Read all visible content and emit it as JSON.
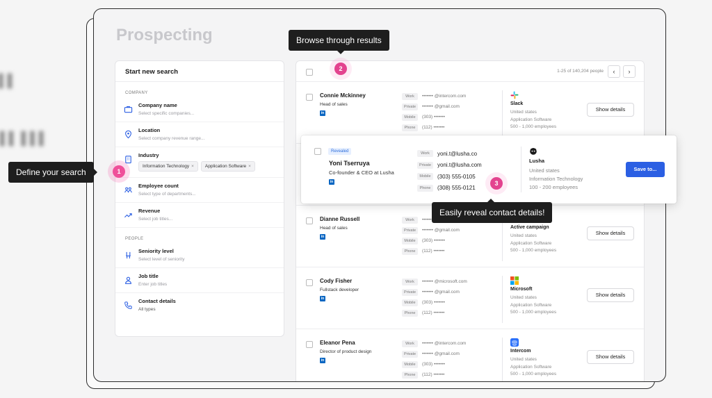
{
  "app": {
    "title": "Prospecting"
  },
  "search_panel": {
    "header": "Start new search",
    "company_section": "COMPANY",
    "people_section": "PEOPLE",
    "filters": {
      "company_name": {
        "title": "Company name",
        "placeholder": "Select specific companies..."
      },
      "location": {
        "title": "Location",
        "placeholder": "Select company revenue range..."
      },
      "industry": {
        "title": "Industry",
        "chips": [
          "Information Technology",
          "Application Software"
        ]
      },
      "employee_count": {
        "title": "Employee count",
        "placeholder": "Select type of departments..."
      },
      "revenue": {
        "title": "Revenue",
        "placeholder": "Select job titles..."
      },
      "seniority": {
        "title": "Seniority level",
        "placeholder": "Select level of seniority"
      },
      "job_title": {
        "title": "Job title",
        "placeholder": "Enter job titles"
      },
      "contact_details": {
        "title": "Contact details",
        "value": "All types"
      }
    }
  },
  "results": {
    "count": "1-25 of 140,204 people",
    "prev": "‹",
    "next": "›",
    "show_details": "Show details",
    "labels": {
      "work": "Work",
      "private": "Private",
      "mobile": "Mobile",
      "phone": "Phone"
    },
    "rows": [
      {
        "name": "Connie Mckinney",
        "role": "Head of sales",
        "work": "••••••• @intercom.com",
        "private": "••••••• @gmail.com",
        "mobile": "(303) •••••••",
        "phone": "(112) •••••••",
        "company": "Slack",
        "location": "United states",
        "industry": "Application Software",
        "size": "500 - 1,000 employees"
      },
      {
        "name": "Dianne Russell",
        "role": "Head of sales",
        "work": "••••••• @intercom.com",
        "private": "••••••• @gmail.com",
        "mobile": "(303) •••••••",
        "phone": "(112) •••••••",
        "company": "Active campaign",
        "location": "United states",
        "industry": "Application Software",
        "size": "500 - 1,000 employees"
      },
      {
        "name": "Cody Fisher",
        "role": "Fullstack developer",
        "work": "••••••• @microsoft.com",
        "private": "••••••• @gmail.com",
        "mobile": "(303) •••••••",
        "phone": "(112) •••••••",
        "company": "Microsoft",
        "location": "United states",
        "industry": "Application Software",
        "size": "500 - 1,000 employees"
      },
      {
        "name": "Eleanor Pena",
        "role": "Director of product design",
        "work": "••••••• @intercom.com",
        "private": "••••••• @gmail.com",
        "mobile": "(303) •••••••",
        "phone": "(112) •••••••",
        "company": "Intercom",
        "location": "United states",
        "industry": "Application Software",
        "size": "500 - 1,000 employees"
      }
    ]
  },
  "revealed": {
    "badge": "Revealed",
    "name": "Yoni Tserruya",
    "role": "Co-founder & CEO at Lusha",
    "work": "yoni.t@lusha.co",
    "private": "yoni.t@lusha.com",
    "mobile": "(303) 555-0105",
    "phone": "(308) 555-0121",
    "company": "Lusha",
    "location": "United states",
    "industry": "Information Technology",
    "size": "100 - 200 employees",
    "save": "Save to..."
  },
  "tooltips": {
    "define": "Define your search",
    "browse": "Browse through results",
    "reveal": "Easily reveal contact details!"
  },
  "steps": [
    "1",
    "2",
    "3"
  ],
  "colors": {
    "accent": "#2b5fe3",
    "step_pink": "#ef4f9a",
    "tooltip_bg": "#1e1e1e"
  }
}
